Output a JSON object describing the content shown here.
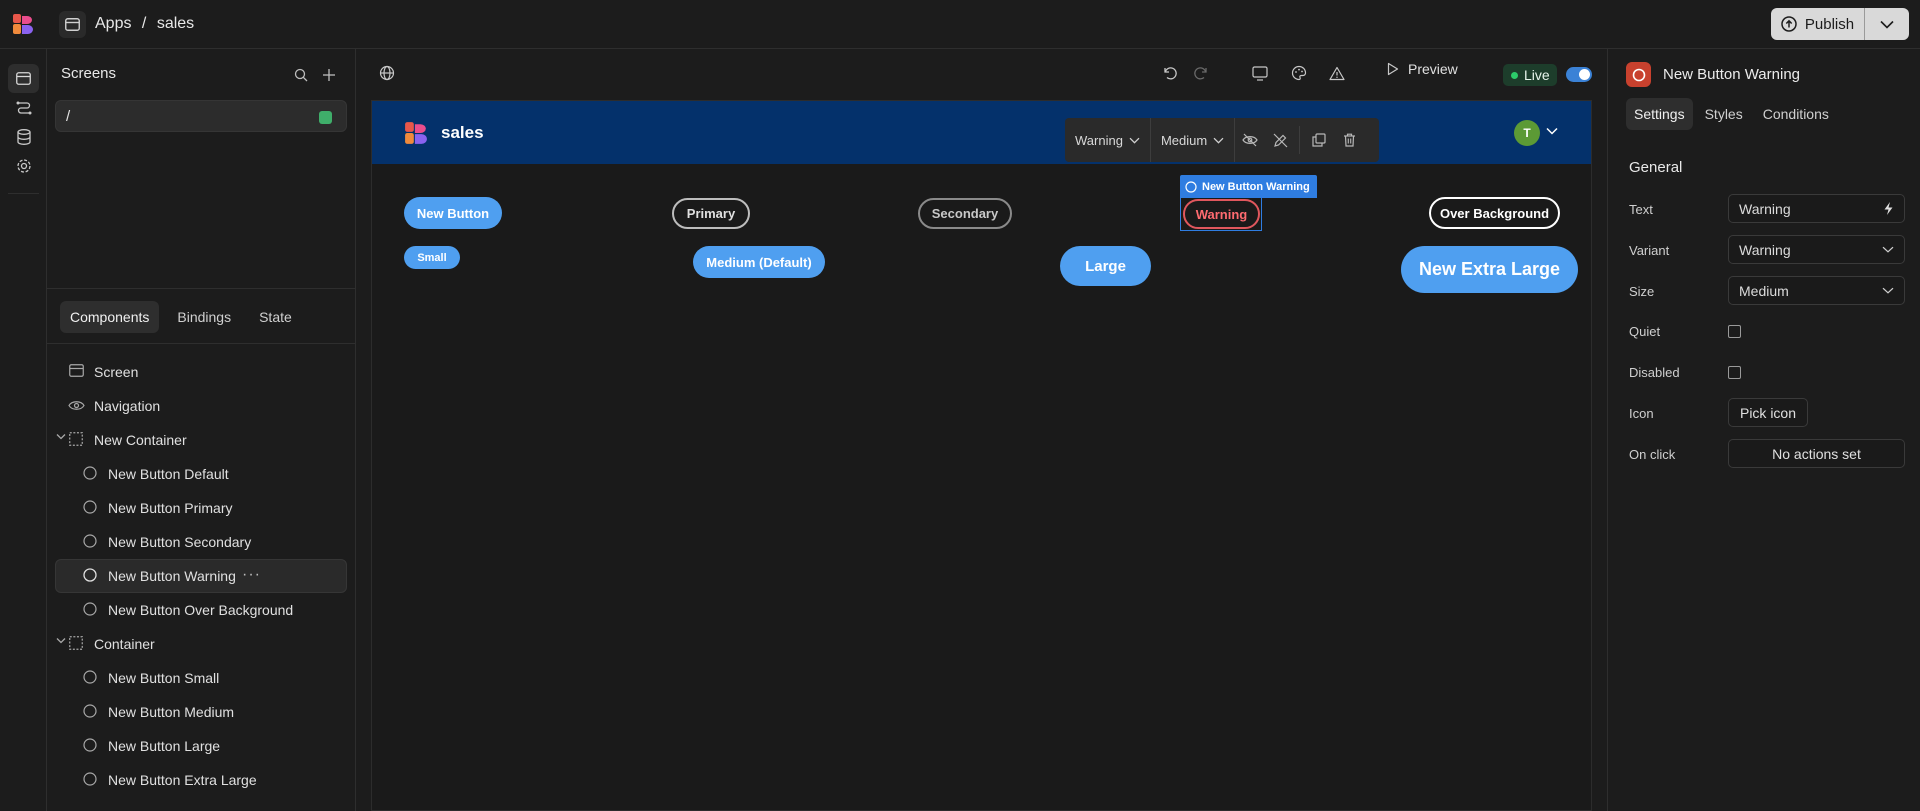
{
  "topbar": {
    "breadcrumb": [
      "Apps",
      "/",
      "sales"
    ],
    "publish_label": "Publish"
  },
  "screens_panel": {
    "title": "Screens",
    "screens": [
      {
        "path": "/"
      }
    ]
  },
  "component_tabs": [
    "Components",
    "Bindings",
    "State"
  ],
  "tree": [
    {
      "label": "Screen",
      "icon": "screen-icon",
      "depth": 0
    },
    {
      "label": "Navigation",
      "icon": "eye-icon",
      "depth": 0
    },
    {
      "label": "New Container",
      "icon": "container-icon",
      "depth": 0,
      "expanded": true
    },
    {
      "label": "New Button Default",
      "icon": "button-circle-icon",
      "depth": 1
    },
    {
      "label": "New Button Primary",
      "icon": "button-circle-icon",
      "depth": 1
    },
    {
      "label": "New Button Secondary",
      "icon": "button-circle-icon",
      "depth": 1
    },
    {
      "label": "New Button Warning",
      "icon": "button-circle-icon",
      "depth": 1,
      "selected": true
    },
    {
      "label": "New Button Over Background",
      "icon": "button-circle-icon",
      "depth": 1
    },
    {
      "label": "Container",
      "icon": "container-icon",
      "depth": 0,
      "expanded": true
    },
    {
      "label": "New Button Small",
      "icon": "button-circle-icon",
      "depth": 1
    },
    {
      "label": "New Button Medium",
      "icon": "button-circle-icon",
      "depth": 1
    },
    {
      "label": "New Button Large",
      "icon": "button-circle-icon",
      "depth": 1
    },
    {
      "label": "New Button Extra Large",
      "icon": "button-circle-icon",
      "depth": 1
    }
  ],
  "canvas": {
    "preview_label": "Preview",
    "live_label": "Live",
    "live_toggle_on": true,
    "app_title": "sales",
    "avatar_initial": "T",
    "floating_toolbar": {
      "variant": "Warning",
      "size": "Medium"
    },
    "selected_tag": "New Button Warning",
    "buttons_row1": [
      "New Button",
      "Primary",
      "Secondary",
      "Warning",
      "Over Background"
    ],
    "buttons_row2": [
      "Small",
      "Medium (Default)",
      "Large",
      "New Extra Large"
    ]
  },
  "settings": {
    "component_name": "New Button Warning",
    "tabs": [
      "Settings",
      "Styles",
      "Conditions"
    ],
    "section": "General",
    "labels": {
      "text": "Text",
      "variant": "Variant",
      "size": "Size",
      "quiet": "Quiet",
      "disabled": "Disabled",
      "icon": "Icon",
      "on_click": "On click"
    },
    "values": {
      "text": "Warning",
      "variant": "Warning",
      "size": "Medium",
      "quiet": false,
      "disabled": false,
      "icon_button": "Pick icon",
      "on_click_button": "No actions set"
    }
  },
  "colors": {
    "accent": "#4f9ff0",
    "selection": "#2f7de1",
    "app_nav": "#04316b",
    "warning": "#e0575d",
    "live_green": "#2ccb6a",
    "component_icon": "#c8412e"
  }
}
